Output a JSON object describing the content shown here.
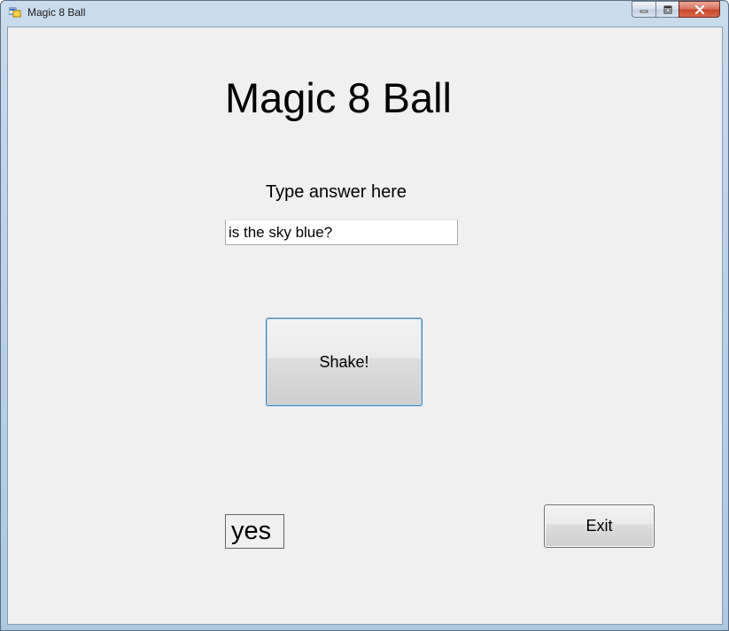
{
  "window": {
    "title": "Magic 8 Ball",
    "controls": {
      "minimize_icon": "minimize-icon",
      "maximize_icon": "restore-icon",
      "close_icon": "close-icon"
    },
    "close_color": "#c4452b"
  },
  "form": {
    "heading": "Magic 8 Ball",
    "prompt_label": "Type answer here",
    "question_value": "is the sky blue?",
    "shake_label": "Shake!",
    "result_text": "yes",
    "exit_label": "Exit",
    "background": "#f0f0f0"
  }
}
